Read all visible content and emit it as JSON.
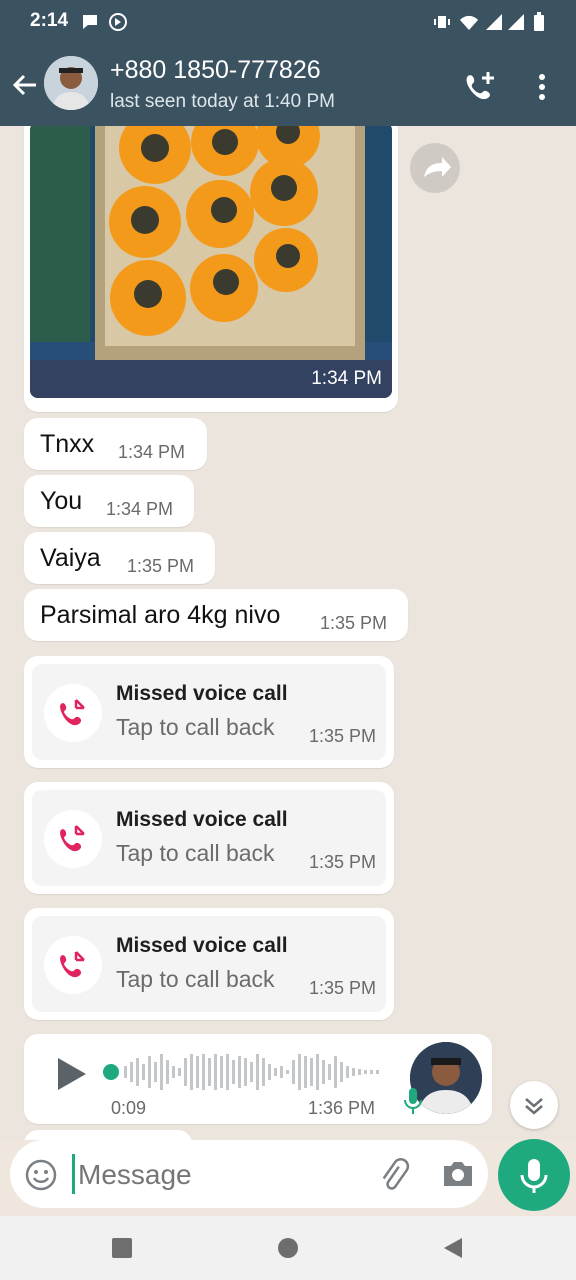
{
  "status": {
    "time": "2:14"
  },
  "header": {
    "contact": "+880 1850-777826",
    "last_seen": "last seen today at 1:40 PM"
  },
  "messages": {
    "photo_time": "1:34 PM",
    "m1": {
      "text": "Tnxx",
      "time": "1:34 PM"
    },
    "m2": {
      "text": "You",
      "time": "1:34 PM"
    },
    "m3": {
      "text": "Vaiya",
      "time": "1:35 PM"
    },
    "m4": {
      "text": "Parsimal aro 4kg nivo",
      "time": "1:35 PM"
    },
    "calls": [
      {
        "title": "Missed voice call",
        "subtitle": "Tap to call back",
        "time": "1:35 PM"
      },
      {
        "title": "Missed voice call",
        "subtitle": "Tap to call back",
        "time": "1:35 PM"
      },
      {
        "title": "Missed voice call",
        "subtitle": "Tap to call back",
        "time": "1:35 PM"
      }
    ],
    "voice": {
      "duration": "0:09",
      "time": "1:36 PM"
    }
  },
  "input": {
    "placeholder": "Message"
  },
  "colors": {
    "header_bg": "#3b5261",
    "accent": "#1ea97f",
    "missed": "#e0245e",
    "chat_bg": "#ece5dd"
  }
}
